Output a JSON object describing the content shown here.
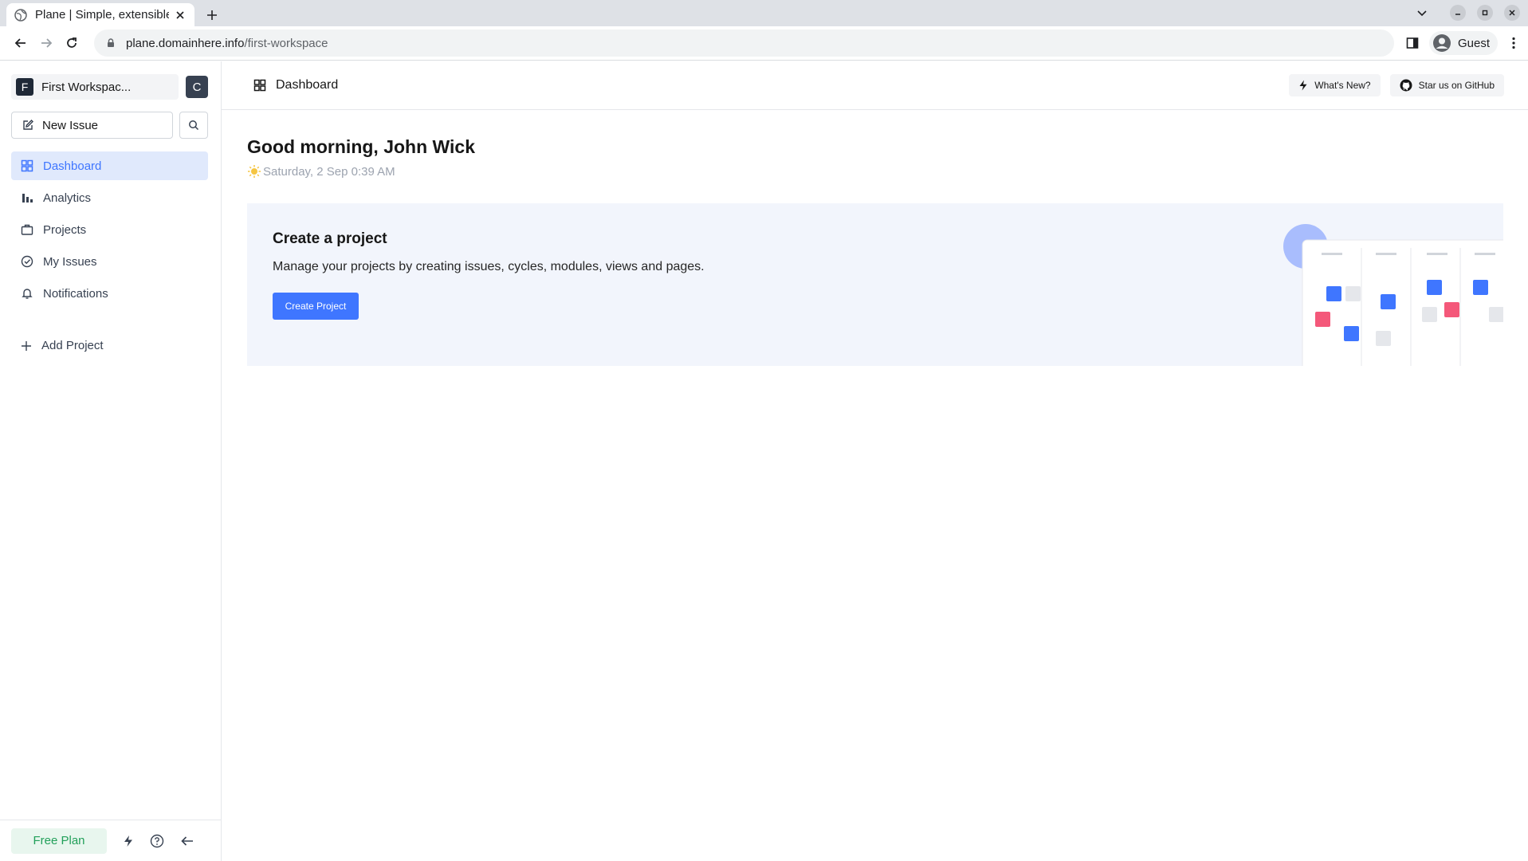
{
  "browser": {
    "tab_title": "Plane | Simple, extensible",
    "url_host": "plane.domainhere.info",
    "url_path": "/first-workspace",
    "profile_label": "Guest"
  },
  "sidebar": {
    "workspace_initial": "F",
    "workspace_name": "First Workspac...",
    "user_initial": "C",
    "new_issue_label": "New Issue",
    "nav": [
      {
        "label": "Dashboard",
        "icon": "grid-icon",
        "active": true
      },
      {
        "label": "Analytics",
        "icon": "bar-chart-icon",
        "active": false
      },
      {
        "label": "Projects",
        "icon": "briefcase-icon",
        "active": false
      },
      {
        "label": "My Issues",
        "icon": "check-circle-icon",
        "active": false
      },
      {
        "label": "Notifications",
        "icon": "bell-icon",
        "active": false
      }
    ],
    "add_project_label": "Add Project",
    "footer": {
      "plan_label": "Free Plan"
    }
  },
  "header": {
    "breadcrumb": "Dashboard",
    "whats_new_label": "What's New?",
    "github_label": "Star us on GitHub"
  },
  "greeting": {
    "title": "Good morning, John Wick",
    "date": "Saturday, 2 Sep 0:39 AM"
  },
  "project_card": {
    "title": "Create a project",
    "description": "Manage your projects by creating issues, cycles, modules, views and pages.",
    "button_label": "Create Project"
  },
  "colors": {
    "accent": "#3f76ff",
    "active_bg": "#e0e9fc",
    "card_bg": "#f2f5fc",
    "free_plan_text": "#22a05a",
    "illustration_pink": "#f4587a"
  }
}
